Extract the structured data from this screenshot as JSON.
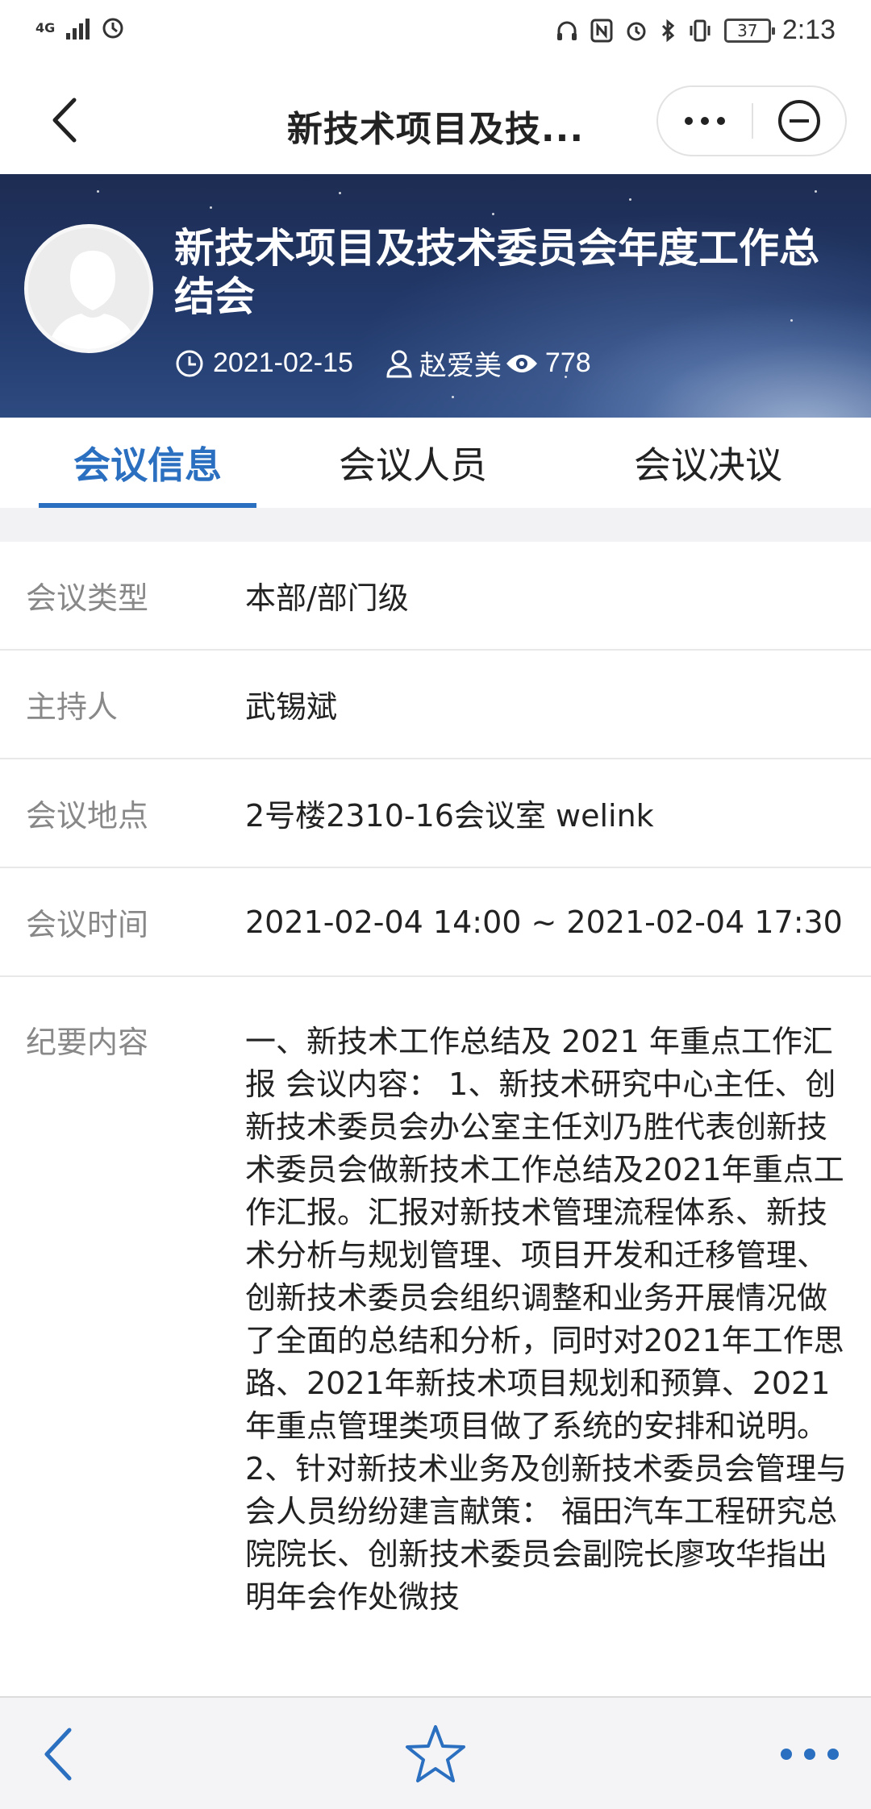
{
  "status_bar": {
    "network": "4G",
    "time": "2:13",
    "battery": "37"
  },
  "header": {
    "title": "新技术项目及技..."
  },
  "banner": {
    "title": "新技术项目及技术委员会年度工作总结会",
    "date": "2021-02-15",
    "author": "赵爱美",
    "views": "778"
  },
  "tabs": [
    {
      "label": "会议信息",
      "active": true
    },
    {
      "label": "会议人员",
      "active": false
    },
    {
      "label": "会议决议",
      "active": false
    }
  ],
  "info": {
    "type_label": "会议类型",
    "type_value": "本部/部门级",
    "host_label": "主持人",
    "host_value": "武锡斌",
    "location_label": "会议地点",
    "location_value": "2号楼2310-16会议室 welink",
    "time_label": "会议时间",
    "time_value": "2021-02-04 14:00 ~ 2021-02-04 17:30",
    "summary_label": "纪要内容",
    "summary_value": "一、新技术工作总结及 2021 年重点工作汇报 会议内容： 1、新技术研究中心主任、创新技术委员会办公室主任刘乃胜代表创新技术委员会做新技术工作总结及2021年重点工作汇报。汇报对新技术管理流程体系、新技术分析与规划管理、项目开发和迁移管理、创新技术委员会组织调整和业务开展情况做了全面的总结和分析，同时对2021年工作思路、2021年新技术项目规划和预算、2021年重点管理类项目做了系统的安排和说明。 2、针对新技术业务及创新技术委员会管理与会人员纷纷建言献策： 福田汽车工程研究总院院长、创新技术委员会副院长廖攻华指出明年会作处微技"
  },
  "colors": {
    "accent": "#2a6fc0",
    "banner_dark": "#1d2c52"
  },
  "icons": {
    "back": "chevron-left-icon",
    "more": "more-dots-icon",
    "minimize": "minimize-circle-icon",
    "clock": "clock-icon",
    "user": "user-icon",
    "views": "eye-icon",
    "favorite": "star-icon"
  }
}
